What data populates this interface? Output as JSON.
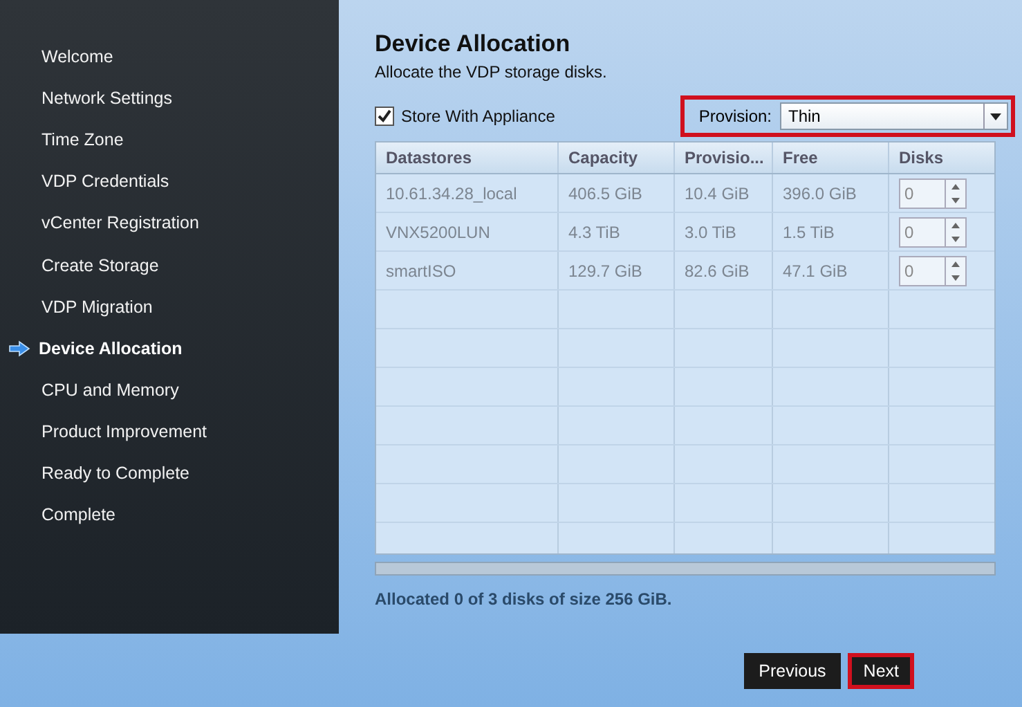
{
  "sidebar": {
    "items": [
      {
        "label": "Welcome",
        "selected": false
      },
      {
        "label": "Network Settings",
        "selected": false
      },
      {
        "label": "Time Zone",
        "selected": false
      },
      {
        "label": "VDP Credentials",
        "selected": false
      },
      {
        "label": "vCenter Registration",
        "selected": false
      },
      {
        "label": "Create Storage",
        "selected": false
      },
      {
        "label": "VDP Migration",
        "selected": false
      },
      {
        "label": "Device Allocation",
        "selected": true
      },
      {
        "label": "CPU and Memory",
        "selected": false
      },
      {
        "label": "Product Improvement",
        "selected": false
      },
      {
        "label": "Ready to Complete",
        "selected": false
      },
      {
        "label": "Complete",
        "selected": false
      }
    ]
  },
  "page": {
    "title": "Device Allocation",
    "subtitle": "Allocate the VDP storage disks.",
    "store_with_appliance": {
      "label": "Store With Appliance",
      "checked": true
    },
    "provision": {
      "label": "Provision:",
      "value": "Thin",
      "highlighted": true
    }
  },
  "table": {
    "columns": [
      "Datastores",
      "Capacity",
      "Provisio...",
      "Free",
      "Disks"
    ],
    "rows": [
      {
        "cells": [
          "10.61.34.28_local",
          "406.5 GiB",
          "10.4 GiB",
          "396.0 GiB"
        ],
        "disks": "0"
      },
      {
        "cells": [
          "VNX5200LUN",
          "4.3 TiB",
          "3.0 TiB",
          "1.5 TiB"
        ],
        "disks": "0"
      },
      {
        "cells": [
          "smartISO",
          "129.7 GiB",
          "82.6 GiB",
          "47.1 GiB"
        ],
        "disks": "0"
      }
    ]
  },
  "summary": "Allocated 0 of 3 disks of size 256 GiB.",
  "buttons": [
    {
      "label": "Previous",
      "highlighted": false
    },
    {
      "label": "Next",
      "highlighted": true
    }
  ]
}
